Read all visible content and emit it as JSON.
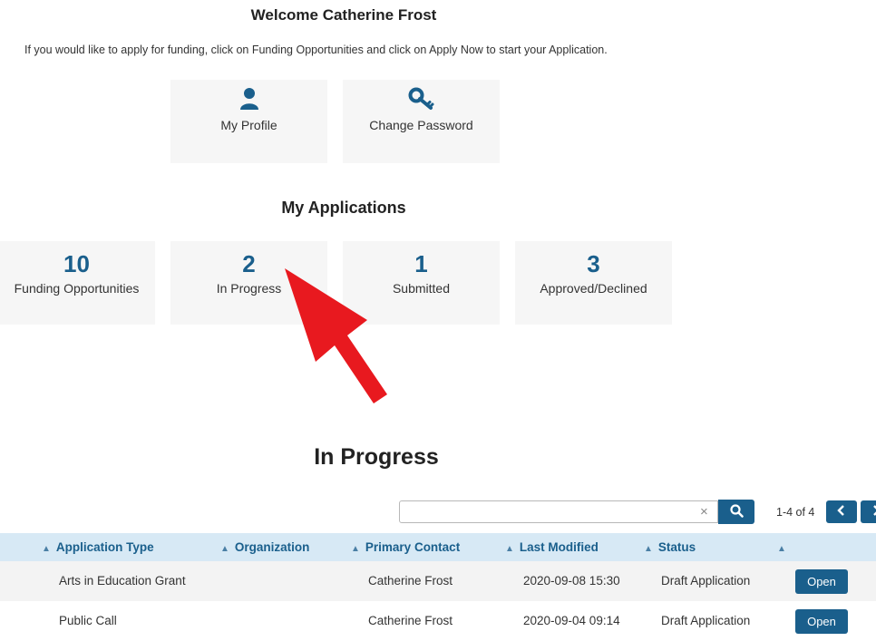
{
  "header": {
    "welcome": "Welcome Catherine Frost",
    "intro": "If you would like to apply for funding, click on Funding Opportunities and click on Apply Now to start your Application."
  },
  "quick_links": [
    {
      "label": "My Profile",
      "icon": "user-icon"
    },
    {
      "label": "Change Password",
      "icon": "key-icon"
    }
  ],
  "my_applications": {
    "title": "My Applications",
    "tiles": [
      {
        "count": "10",
        "label": "Funding Opportunities"
      },
      {
        "count": "2",
        "label": "In Progress"
      },
      {
        "count": "1",
        "label": "Submitted"
      },
      {
        "count": "3",
        "label": "Approved/Declined"
      }
    ]
  },
  "in_progress": {
    "title": "In Progress",
    "search": {
      "value": "",
      "clear": "×"
    },
    "pagination": {
      "text": "1-4 of 4"
    },
    "columns": [
      "Application Type",
      "Organization",
      "Primary Contact",
      "Last Modified",
      "Status",
      ""
    ],
    "rows": [
      {
        "application_type": "Arts in Education Grant",
        "organization": "",
        "primary_contact": "Catherine Frost",
        "last_modified": "2020-09-08 15:30",
        "status": "Draft Application",
        "action": "Open"
      },
      {
        "application_type": "Public Call",
        "organization": "",
        "primary_contact": "Catherine Frost",
        "last_modified": "2020-09-04 09:14",
        "status": "Draft Application",
        "action": "Open"
      }
    ]
  },
  "colors": {
    "accent": "#1a5f8c",
    "header_bg": "#d7e9f5",
    "tile_bg": "#f6f6f6",
    "arrow": "#e8191f"
  }
}
